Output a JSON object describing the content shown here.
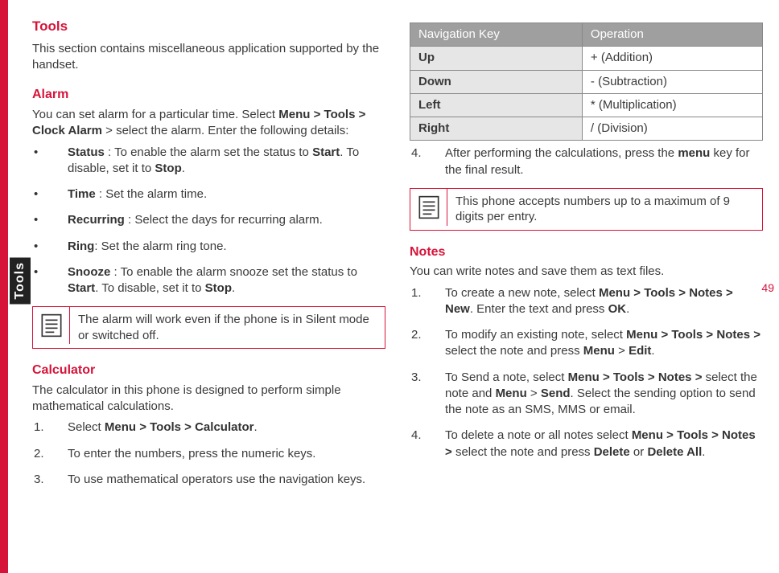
{
  "sideTab": "Tools",
  "pageNumber": "49",
  "left": {
    "h_tools": "Tools",
    "tools_intro": "This section contains miscellaneous application supported by the handset.",
    "h_alarm": "Alarm",
    "alarm_intro_a": "You can set alarm for a particular time. Select ",
    "alarm_intro_b": "Menu > Tools > Clock Alarm",
    "alarm_intro_c": " > select the alarm. Enter the following details:",
    "b_status_k": "Status",
    "b_status_v": " : To enable the alarm set the status to ",
    "b_status_start": "Start",
    "b_status_v2": ". To disable, set it to ",
    "b_status_stop": "Stop",
    "b_status_end": ".",
    "b_time_k": "Time",
    "b_time_v": " : Set the alarm time.",
    "b_recur_k": "Recurring",
    "b_recur_v": " : Select the days for recurring alarm.",
    "b_ring_k": "Ring",
    "b_ring_v": ": Set the alarm ring tone.",
    "b_snooze_k": "Snooze",
    "b_snooze_v": " : To enable the alarm snooze set the status to ",
    "b_snooze_start": "Start",
    "b_snooze_v2": ". To disable, set it to ",
    "b_snooze_stop": "Stop",
    "b_snooze_end": ".",
    "note1": "The alarm will work even if the phone is in Silent mode or switched off.",
    "h_calc": "Calculator",
    "calc_intro": "The calculator in this phone is designed to perform simple mathematical calculations.",
    "step1_a": "Select ",
    "step1_b": "Menu > Tools > Calculator",
    "step1_c": ".",
    "step2": "To enter the numbers, press the numeric keys.",
    "step3": "To use mathematical operators use the navigation keys."
  },
  "right": {
    "th1": "Navigation Key",
    "th2": "Operation",
    "r1k": "Up",
    "r1v": "+ (Addition)",
    "r2k": "Down",
    "r2v": "- (Subtraction)",
    "r3k": "Left",
    "r3v": "* (Multiplication)",
    "r4k": "Right",
    "r4v": "/ (Division)",
    "step4_a": "After performing the calculations, press the ",
    "step4_b": "menu",
    "step4_c": " key for the final result.",
    "note2": "This phone accepts numbers up to a maximum of 9 digits per entry.",
    "h_notes": "Notes",
    "notes_intro": "You can write notes and save them as text files.",
    "n1_a": "To create a new note, select ",
    "n1_b": "Menu > Tools > Notes > New",
    "n1_c": ". Enter the text and press ",
    "n1_d": "OK",
    "n1_e": ".",
    "n2_a": "To modify an existing note, select ",
    "n2_b": "Menu > Tools > Notes > ",
    "n2_c": "select the note and press ",
    "n2_d": "Menu",
    "n2_e": " > ",
    "n2_f": "Edit",
    "n2_g": ".",
    "n3_a": "To Send a note, select ",
    "n3_b": "Menu > Tools > Notes > ",
    "n3_c": "select the note and ",
    "n3_d": "Menu",
    "n3_e": " > ",
    "n3_f": "Send",
    "n3_g": ". Select the sending option to send the note as an SMS, MMS or email.",
    "n4_a": "To delete a note or all notes select ",
    "n4_b": "Menu > Tools > Notes > ",
    "n4_c": "select the note and press ",
    "n4_d": "Delete",
    "n4_e": "  or ",
    "n4_f": "Delete All",
    "n4_g": "."
  },
  "numbers": {
    "1": "1.",
    "2": "2.",
    "3": "3.",
    "4": "4."
  }
}
